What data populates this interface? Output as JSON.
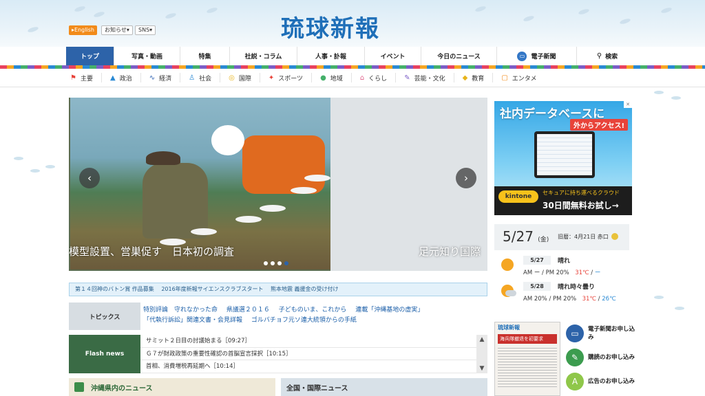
{
  "header": {
    "logo": "琉球新報",
    "utility": {
      "english": "▸English",
      "notices": "お知らせ▾",
      "sns": "SNS▾"
    }
  },
  "main_nav": [
    {
      "label": "トップ",
      "active": true
    },
    {
      "label": "写真・動画"
    },
    {
      "label": "特集"
    },
    {
      "label": "社説・コラム"
    },
    {
      "label": "人事・訃報"
    },
    {
      "label": "イベント"
    },
    {
      "label": "今日のニュース"
    },
    {
      "label": "電子新聞",
      "icon": "monitor-icon"
    },
    {
      "label": "検索",
      "icon": "search-icon"
    }
  ],
  "sub_nav": [
    {
      "label": "主要",
      "icon": "flag-icon",
      "color": "#e8433a"
    },
    {
      "label": "政治",
      "icon": "building-icon",
      "color": "#2a8ad4"
    },
    {
      "label": "経済",
      "icon": "trend-icon",
      "color": "#2a5fb0"
    },
    {
      "label": "社会",
      "icon": "people-icon",
      "color": "#2a8ad4"
    },
    {
      "label": "国際",
      "icon": "globe-icon",
      "color": "#e8b41a"
    },
    {
      "label": "スポーツ",
      "icon": "runner-icon",
      "color": "#e8433a"
    },
    {
      "label": "地域",
      "icon": "pin-icon",
      "color": "#45b06a"
    },
    {
      "label": "くらし",
      "icon": "house-icon",
      "color": "#e0608a"
    },
    {
      "label": "芸能・文化",
      "icon": "brush-icon",
      "color": "#7b5ec7"
    },
    {
      "label": "教育",
      "icon": "cap-icon",
      "color": "#e8b41a"
    },
    {
      "label": "エンタメ",
      "icon": "screen-icon",
      "color": "#f28b1a"
    }
  ],
  "slider": {
    "caption_left": "模型設置、営巣促す　日本初の調査",
    "caption_right": "足元知り国際",
    "dots": 4,
    "active_dot": 4
  },
  "ticker": "第１４回神のバトン賞 作品募集　 2016年度新報サイエンスクラブスタート　 熊本地震 義援金の受け付け",
  "topics": {
    "label": "トピックス",
    "links": [
      "特別評論　守れなかった命",
      "県議選２０１６",
      "子どものいま、これから",
      "連載「沖縄基地の虚実」",
      "「代執行訴訟」関連文書・会見詳報",
      "ゴルバチョフ元ソ連大統領からの手紙"
    ]
  },
  "flash_news": {
    "label": "Flash news",
    "items": [
      "サミット２日目の討議始まる［09:27］",
      "Ｇ７が財政政策の重要性確認の首脳宣言採択［10:15］",
      "首相、消費増税再延期へ［10:14］"
    ]
  },
  "sections": {
    "local": "沖縄県内のニュース",
    "national": "全国・国際ニュース"
  },
  "ad": {
    "headline": "社内データベースに",
    "subhead": "外からアクセス!",
    "brand": "kintone",
    "tagline": "セキュアに持ち運べるクラウド",
    "cta": "30日間無料お試し→",
    "close": "✕"
  },
  "weather": {
    "date": "5/27",
    "weekday": "(金)",
    "lunar": "旧暦：4月21日 赤口",
    "days": [
      {
        "day": "5/27",
        "condition": "晴れ",
        "rain": "AM ー / PM 20%",
        "high": "31℃",
        "low": "ー",
        "icon": "sun-icon"
      },
      {
        "day": "5/28",
        "condition": "晴れ時々曇り",
        "rain": "AM 20% / PM 20%",
        "high": "31℃",
        "low": "26℃",
        "icon": "sun-cloud-icon"
      }
    ]
  },
  "promo": {
    "paper_title": "琉球新報",
    "paper_headline": "海兵隊撤退を初要求",
    "items": [
      {
        "label": "電子新聞お申し込み",
        "icon": "monitor-icon",
        "color": "#2d63a9"
      },
      {
        "label": "購読のお申し込み",
        "icon": "newspaper-icon",
        "color": "#3c9c4f"
      },
      {
        "label": "広告のお申し込み",
        "icon": "ad-icon",
        "color": "#8fc74a"
      }
    ]
  }
}
